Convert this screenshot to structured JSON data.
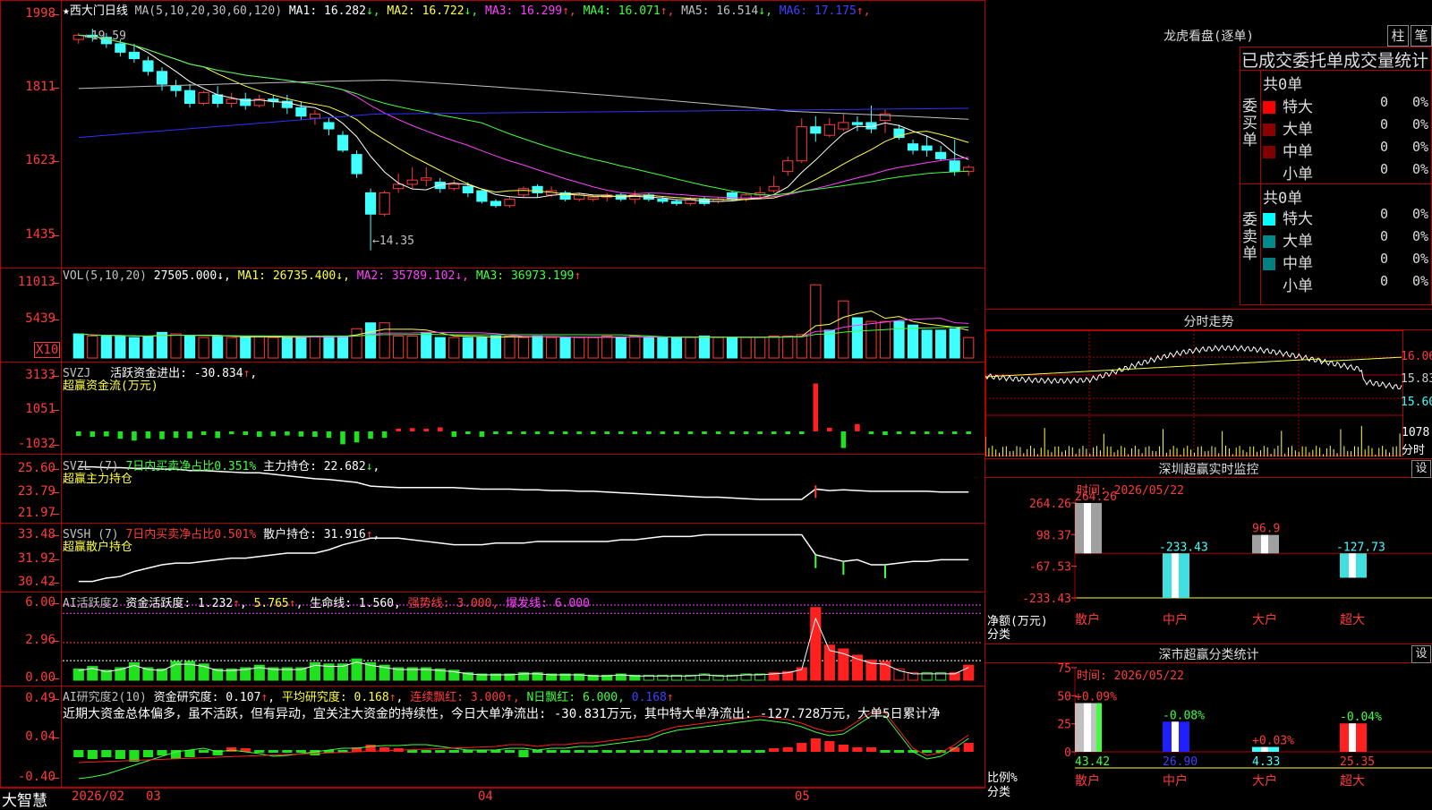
{
  "main": {
    "title": "★西大门日线",
    "ma_label": "MA(5,10,20,30,60,120)",
    "ma": [
      {
        "name": "MA1:",
        "value": "16.282",
        "arrow": "↓",
        "color": "#ffffff"
      },
      {
        "name": "MA2:",
        "value": "16.722",
        "arrow": "↓",
        "color": "#ffff40"
      },
      {
        "name": "MA3:",
        "value": "16.299",
        "arrow": "↑",
        "color": "#ff40ff"
      },
      {
        "name": "MA4:",
        "value": "16.071",
        "arrow": "↑",
        "color": "#40ff40"
      },
      {
        "name": "MA5:",
        "value": "16.514",
        "arrow": "↓",
        "color": "#c0c0c0"
      },
      {
        "name": "MA6:",
        "value": "17.175",
        "arrow": "↑",
        "color": "#4040ff"
      }
    ],
    "y_ticks": [
      "1998",
      "1811",
      "1623",
      "1435"
    ],
    "high_label": "←19.59",
    "low_label": "←14.35"
  },
  "vol": {
    "label": "VOL(5,10,20)",
    "value": "27505.000",
    "arrow": "↓",
    "ma1": "MA1: 26735.400",
    "ma1_arrow": "↓",
    "ma2": "MA2: 35789.102",
    "ma2_arrow": "↓",
    "ma3": "MA3: 36973.199",
    "ma3_arrow": "↑",
    "y_ticks": [
      "11013",
      "5439"
    ],
    "unit": "X10"
  },
  "svzj": {
    "label": "SVZJ",
    "text": "活跃资金进出: -30.834",
    "arrow": "↑",
    "sub": "超赢资金流(万元)",
    "y_ticks": [
      "3133",
      "1051",
      "-1032"
    ]
  },
  "svzl": {
    "label": "SVZL (7)",
    "ratio": "7日内买卖净占比0.351%",
    "hold": "主力持仓: 22.682",
    "arrow": "↓",
    "sub": "超赢主力持仓",
    "y_ticks": [
      "25.60",
      "23.79",
      "21.97"
    ]
  },
  "svsh": {
    "label": "SVSH (7)",
    "ratio": "7日内买卖净占比0.501%",
    "hold": "散户持仓: 31.916",
    "arrow": "↑",
    "sub": "超赢散户持仓",
    "y_ticks": [
      "33.48",
      "31.92",
      "30.42"
    ]
  },
  "ai1": {
    "label": "AI活跃度2",
    "text1": "资金活跃度: 1.232",
    "text2": "5.765",
    "text3": "生命线: 1.560",
    "text4": "强势线: 3.000",
    "text5": "爆发线: 6.000",
    "y_ticks": [
      "6.00",
      "2.96",
      "0.00"
    ]
  },
  "ai2": {
    "label": "AI研究度2(10)",
    "text1": "资金研究度: 0.107",
    "text2": "平均研究度: 0.168",
    "text3": "连续飘红: 3.000",
    "text4": "N日飘红: 6.000,",
    "text5": "0.168",
    "comment": "近期大资金总体偏多，虽不活跃，但有异动，宜关注大资金的持续性，今日大单净流出: -30.831万元，其中特大单净流出: -127.728万元，大单5日累计净",
    "y_ticks": [
      "0.49",
      "0.04",
      "-0.40"
    ]
  },
  "xaxis": {
    "brand": "大智慧",
    "labels": [
      "2026/02",
      "03",
      "04",
      "05"
    ]
  },
  "right": {
    "lhb_title": "龙虎看盘(逐单)",
    "btn_zhu": "柱",
    "btn_bi": "笔",
    "stat_title": "已成交委托单成交量统计",
    "buy_side": "委买单",
    "sell_side": "委卖单",
    "buy_total": "共0单",
    "sell_total": "共0单",
    "rows_buy": [
      {
        "name": "特大",
        "n": "0",
        "pct": "0%",
        "color": "#ff0000"
      },
      {
        "name": "大单",
        "n": "0",
        "pct": "0%",
        "color": "#8b0000"
      },
      {
        "name": "中单",
        "n": "0",
        "pct": "0%",
        "color": "#800000"
      },
      {
        "name": "小单",
        "n": "0",
        "pct": "0%",
        "color": "#000000"
      }
    ],
    "rows_sell": [
      {
        "name": "特大",
        "n": "0",
        "pct": "0%",
        "color": "#00ffff"
      },
      {
        "name": "大单",
        "n": "0",
        "pct": "0%",
        "color": "#008b8b"
      },
      {
        "name": "中单",
        "n": "0",
        "pct": "0%",
        "color": "#008080"
      },
      {
        "name": "小单",
        "n": "0",
        "pct": "0%",
        "color": "#000000"
      }
    ],
    "fs_title": "分时走势",
    "fs_prices": [
      "16.06",
      "15.83",
      "15.60"
    ],
    "fs_vol": "1078",
    "fs_vol_label": "分时",
    "sz_title": "深圳超赢实时监控",
    "sz_btn": "设",
    "sz_time": "时间: 2026/05/22",
    "sz_y": [
      "264.26",
      "98.37",
      "-67.53",
      "-233.43"
    ],
    "sz_net": "净额(万元)",
    "sz_cat": "分类",
    "sz_bars": [
      {
        "cat": "散户",
        "value": 264.26,
        "label": "264.26"
      },
      {
        "cat": "中户",
        "value": -233.43,
        "label": "-233.43"
      },
      {
        "cat": "大户",
        "value": 96.9,
        "label": "96.9"
      },
      {
        "cat": "超大",
        "value": -127.73,
        "label": "-127.73"
      }
    ],
    "cls_title": "深市超赢分类统计",
    "cls_btn": "设",
    "cls_time": "时间: 2026/05/22",
    "cls_y": [
      "75",
      "50",
      "25",
      "0"
    ],
    "cls_ratio": "比例%",
    "cls_cat": "分类",
    "cls_bars": [
      {
        "cat": "散户",
        "value": 43.42,
        "label": "43.42",
        "chg": "+0.09%",
        "color": "#c0c0c0"
      },
      {
        "cat": "中户",
        "value": 26.9,
        "label": "26.90",
        "chg": "-0.08%",
        "color": "#2020ff"
      },
      {
        "cat": "大户",
        "value": 4.33,
        "label": "4.33",
        "chg": "+0.03%",
        "color": "#40ffff"
      },
      {
        "cat": "超大",
        "value": 25.35,
        "label": "25.35",
        "chg": "-0.04%",
        "color": "#ff2020"
      }
    ]
  },
  "chart_data": {
    "type": "candlestick",
    "candles": [
      [
        19.3,
        19.4,
        19.2,
        19.45
      ],
      [
        19.4,
        19.35,
        19.25,
        19.55
      ],
      [
        19.35,
        19.2,
        19.1,
        19.45
      ],
      [
        19.2,
        19.0,
        18.9,
        19.3
      ],
      [
        19.0,
        18.85,
        18.75,
        19.2
      ],
      [
        18.8,
        18.55,
        18.45,
        18.9
      ],
      [
        18.55,
        18.25,
        18.1,
        18.65
      ],
      [
        18.2,
        18.1,
        17.95,
        18.35
      ],
      [
        18.1,
        17.8,
        17.7,
        18.25
      ],
      [
        17.8,
        18.05,
        17.75,
        18.1
      ],
      [
        18.0,
        17.8,
        17.7,
        18.2
      ],
      [
        17.8,
        17.9,
        17.7,
        18.05
      ],
      [
        17.9,
        17.75,
        17.65,
        18.05
      ],
      [
        17.75,
        17.9,
        17.7,
        18.0
      ],
      [
        17.9,
        17.85,
        17.7,
        18.0
      ],
      [
        17.85,
        17.7,
        17.55,
        18.0
      ],
      [
        17.7,
        17.5,
        17.4,
        17.85
      ],
      [
        17.45,
        17.55,
        17.3,
        17.65
      ],
      [
        17.35,
        17.2,
        17.05,
        17.45
      ],
      [
        17.05,
        16.7,
        16.65,
        17.15
      ],
      [
        16.6,
        16.15,
        16.05,
        16.7
      ],
      [
        15.7,
        15.2,
        14.35,
        15.8
      ],
      [
        15.2,
        15.7,
        15.15,
        15.75
      ],
      [
        15.8,
        15.9,
        15.7,
        16.15
      ],
      [
        15.9,
        16.0,
        15.8,
        16.3
      ],
      [
        16.0,
        16.05,
        15.85,
        16.3
      ],
      [
        15.95,
        15.8,
        15.7,
        16.05
      ],
      [
        15.8,
        15.9,
        15.75,
        16.0
      ],
      [
        15.85,
        15.7,
        15.6,
        15.95
      ],
      [
        15.75,
        15.5,
        15.45,
        15.8
      ],
      [
        15.5,
        15.4,
        15.35,
        15.55
      ],
      [
        15.4,
        15.55,
        15.35,
        15.6
      ],
      [
        15.65,
        15.8,
        15.6,
        15.85
      ],
      [
        15.85,
        15.7,
        15.6,
        15.9
      ],
      [
        15.65,
        15.75,
        15.6,
        15.85
      ],
      [
        15.7,
        15.55,
        15.5,
        15.75
      ],
      [
        15.55,
        15.65,
        15.5,
        15.7
      ],
      [
        15.55,
        15.6,
        15.5,
        15.65
      ],
      [
        15.6,
        15.65,
        15.5,
        15.7
      ],
      [
        15.65,
        15.55,
        15.5,
        15.7
      ],
      [
        15.55,
        15.65,
        15.45,
        15.75
      ],
      [
        15.65,
        15.55,
        15.5,
        15.7
      ],
      [
        15.55,
        15.5,
        15.45,
        15.6
      ],
      [
        15.5,
        15.45,
        15.4,
        15.55
      ],
      [
        15.45,
        15.55,
        15.4,
        15.6
      ],
      [
        15.55,
        15.45,
        15.4,
        15.6
      ],
      [
        15.5,
        15.55,
        15.45,
        15.6
      ],
      [
        15.7,
        15.55,
        15.5,
        15.75
      ],
      [
        15.55,
        15.65,
        15.5,
        15.7
      ],
      [
        15.65,
        15.7,
        15.55,
        15.85
      ],
      [
        15.75,
        15.85,
        15.7,
        16.1
      ],
      [
        16.2,
        16.45,
        16.1,
        16.55
      ],
      [
        16.45,
        17.25,
        16.4,
        17.45
      ],
      [
        17.25,
        17.1,
        16.9,
        17.5
      ],
      [
        17.05,
        17.3,
        17.0,
        17.45
      ],
      [
        17.2,
        17.35,
        17.15,
        17.55
      ],
      [
        17.35,
        17.3,
        17.15,
        17.5
      ],
      [
        17.35,
        17.2,
        17.1,
        17.75
      ],
      [
        17.4,
        17.55,
        17.1,
        17.65
      ],
      [
        17.2,
        17.0,
        16.95,
        17.3
      ],
      [
        16.85,
        16.7,
        16.6,
        16.95
      ],
      [
        16.8,
        16.7,
        16.55,
        17.05
      ],
      [
        16.65,
        16.5,
        16.45,
        16.8
      ],
      [
        16.45,
        16.2,
        16.1,
        16.95
      ],
      [
        16.2,
        16.3,
        16.1,
        16.35
      ]
    ],
    "y_range": [
      14.05,
      20.1
    ],
    "vol": [
      33,
      30,
      30,
      30,
      28,
      30,
      35,
      33,
      30,
      28,
      30,
      28,
      28,
      30,
      28,
      28,
      28,
      30,
      30,
      30,
      40,
      48,
      48,
      30,
      30,
      35,
      28,
      28,
      28,
      28,
      30,
      30,
      28,
      30,
      28,
      28,
      28,
      28,
      30,
      28,
      30,
      28,
      28,
      28,
      28,
      30,
      28,
      28,
      28,
      28,
      30,
      30,
      32,
      100,
      38,
      78,
      55,
      50,
      50,
      50,
      45,
      38,
      38,
      40,
      28
    ],
    "vol_colors_red": [
      0,
      1,
      0,
      0,
      0,
      0,
      0,
      1,
      0,
      1,
      0,
      1,
      0,
      1,
      1,
      0,
      0,
      1,
      0,
      0,
      1,
      0,
      1,
      1,
      1,
      0,
      0,
      1,
      0,
      0,
      0,
      1,
      1,
      0,
      1,
      0,
      1,
      1,
      1,
      0,
      1,
      0,
      0,
      0,
      1,
      0,
      1,
      0,
      1,
      1,
      1,
      1,
      1,
      1,
      0,
      1,
      0,
      1,
      1,
      0,
      0,
      0,
      0,
      0,
      1
    ],
    "svzj": [
      -250,
      -300,
      -270,
      -400,
      -500,
      -380,
      -420,
      -350,
      -380,
      -200,
      -360,
      -150,
      -200,
      -300,
      -260,
      -220,
      -280,
      -300,
      -350,
      -700,
      -600,
      -400,
      -350,
      80,
      180,
      150,
      220,
      -300,
      -80,
      -300,
      -100,
      -80,
      -60,
      -50,
      -90,
      -100,
      -60,
      -70,
      -50,
      -60,
      -80,
      -40,
      -60,
      -50,
      -60,
      -40,
      -50,
      -40,
      -40,
      -60,
      -30,
      -30,
      -60,
      2600,
      200,
      -900,
      400,
      -150,
      -200,
      -80,
      -80,
      -50,
      -60,
      -70,
      -40
    ],
    "svzl": [
      25.5,
      25.5,
      25.45,
      25.45,
      25.4,
      25.4,
      25.35,
      25.35,
      25.25,
      25.25,
      25.2,
      25.15,
      25.1,
      25.1,
      25.0,
      24.9,
      24.8,
      24.7,
      24.65,
      24.55,
      24.45,
      24.2,
      24.15,
      24.1,
      24.1,
      24.1,
      24.1,
      24.1,
      24.05,
      24.0,
      24.0,
      24.0,
      23.95,
      23.95,
      23.9,
      23.9,
      23.85,
      23.85,
      23.8,
      23.75,
      23.7,
      23.65,
      23.6,
      23.55,
      23.5,
      23.45,
      23.45,
      23.4,
      23.35,
      23.3,
      23.3,
      23.3,
      23.3,
      24.0,
      23.9,
      23.95,
      23.9,
      23.85,
      23.85,
      23.85,
      23.85,
      23.85,
      23.8,
      23.8,
      23.8
    ],
    "svsh": [
      30.6,
      30.6,
      30.8,
      30.9,
      31.2,
      31.4,
      31.6,
      31.7,
      31.7,
      31.8,
      31.9,
      32.0,
      32.0,
      32.1,
      32.2,
      32.3,
      32.3,
      32.3,
      32.5,
      32.8,
      33.0,
      33.2,
      33.2,
      33.2,
      33.1,
      33.0,
      32.9,
      32.8,
      32.8,
      32.8,
      32.9,
      32.9,
      32.9,
      33.0,
      33.0,
      33.0,
      33.0,
      33.0,
      33.0,
      33.1,
      33.1,
      33.2,
      33.3,
      33.3,
      33.3,
      33.4,
      33.4,
      33.4,
      33.4,
      33.4,
      33.4,
      33.4,
      33.4,
      32.2,
      32.0,
      31.8,
      31.9,
      31.6,
      31.6,
      31.7,
      31.8,
      31.8,
      31.9,
      31.9,
      31.9
    ],
    "ai1": [
      0.9,
      1.1,
      0.8,
      1.0,
      1.4,
      1.0,
      0.9,
      1.5,
      1.5,
      1.3,
      0.9,
      0.9,
      1.0,
      1.2,
      1.0,
      1.0,
      1.0,
      1.4,
      1.3,
      1.3,
      1.7,
      1.4,
      1.2,
      1.0,
      1.0,
      1.0,
      0.9,
      0.8,
      0.6,
      0.5,
      0.5,
      0.5,
      0.6,
      0.6,
      0.5,
      0.5,
      0.5,
      0.4,
      0.4,
      0.5,
      0.4,
      0.4,
      0.4,
      0.4,
      0.4,
      0.5,
      0.4,
      0.4,
      0.5,
      0.5,
      0.6,
      0.7,
      1.0,
      5.8,
      2.8,
      2.5,
      2.0,
      1.6,
      1.5,
      0.9,
      0.6,
      0.6,
      0.6,
      0.6,
      1.2
    ],
    "ai2": [
      -0.1,
      -0.12,
      -0.1,
      -0.12,
      -0.15,
      -0.1,
      -0.08,
      -0.12,
      -0.1,
      -0.05,
      -0.08,
      0.05,
      0.02,
      -0.05,
      -0.05,
      -0.05,
      -0.05,
      -0.08,
      -0.05,
      -0.05,
      0.05,
      0.08,
      0.05,
      0.02,
      -0.05,
      -0.05,
      -0.05,
      -0.05,
      -0.05,
      -0.05,
      -0.05,
      -0.05,
      -0.1,
      -0.05,
      -0.05,
      -0.05,
      -0.05,
      -0.05,
      -0.05,
      -0.05,
      -0.05,
      -0.05,
      -0.05,
      -0.05,
      -0.05,
      -0.05,
      -0.05,
      -0.05,
      -0.05,
      -0.05,
      0.02,
      0.05,
      0.1,
      0.15,
      0.12,
      0.08,
      0.05,
      0.05,
      -0.05,
      -0.05,
      -0.05,
      -0.05,
      -0.05,
      0.05,
      0.1
    ]
  }
}
